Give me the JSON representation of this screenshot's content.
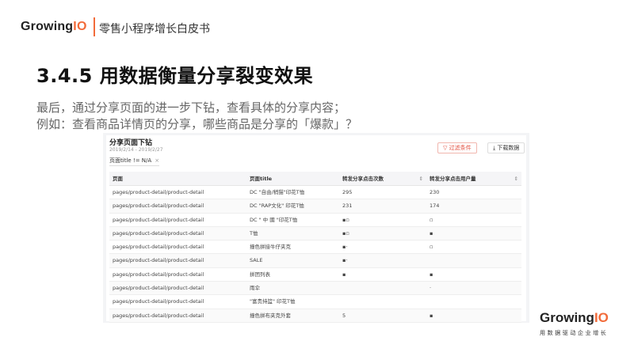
{
  "header": {
    "logo_prefix": "Growing",
    "logo_suffix": "IO",
    "title": "零售小程序增长白皮书"
  },
  "section": {
    "heading": "3.4.5 用数据衡量分享裂变效果",
    "desc_line1": "最后，通过分享页面的进一步下钻，查看具体的分享内容；",
    "desc_line2": "例如：查看商品详情页的分享，哪些商品是分享的「爆款」？"
  },
  "panel": {
    "title": "分享页面下钻",
    "date_range": "2019/2/14 - 2019/2/27",
    "filter_chip": "页面title != N/A",
    "filter_chip_close": "×",
    "filter_button": "过滤条件",
    "filter_icon": "▽",
    "download_button": "下载数据",
    "download_icon": "⤓"
  },
  "table": {
    "headers": [
      "页面",
      "页面title",
      "转发分享点击次数",
      "转发分享点击用户量"
    ],
    "sort_icon": "⇕",
    "rows": [
      [
        "pages/product-detail/product-detail",
        "DC \"自由/稍猫\"印花T恤",
        "295",
        "230"
      ],
      [
        "pages/product-detail/product-detail",
        "DC \"RAP文化\" 印花T恤",
        "231",
        "174"
      ],
      [
        "pages/product-detail/product-detail",
        "DC \" 中 國 \"印花T恤",
        "▪▫",
        "▫"
      ],
      [
        "pages/product-detail/product-detail",
        "T恤",
        "▪▫",
        "▪"
      ],
      [
        "pages/product-detail/product-detail",
        "撞色拼接牛仔夹克",
        "▪·",
        "▫"
      ],
      [
        "pages/product-detail/product-detail",
        "SALE",
        "▪·",
        ""
      ],
      [
        "pages/product-detail/product-detail",
        "拼团列表",
        "▪",
        "▪"
      ],
      [
        "pages/product-detail/product-detail",
        "雨伞",
        "",
        "·"
      ],
      [
        "pages/product-detail/product-detail",
        "\"富贵持篮\" 印花T恤",
        "",
        ""
      ],
      [
        "pages/product-detail/product-detail",
        "撞色拼布夹克外套",
        "5",
        "▪"
      ]
    ]
  },
  "footer": {
    "logo_prefix": "Growing",
    "logo_suffix": "IO",
    "slogan": "用数据驱动企业增长"
  },
  "colors": {
    "brand_orange": "#f26b3a",
    "filter_red": "#e24b3b"
  }
}
